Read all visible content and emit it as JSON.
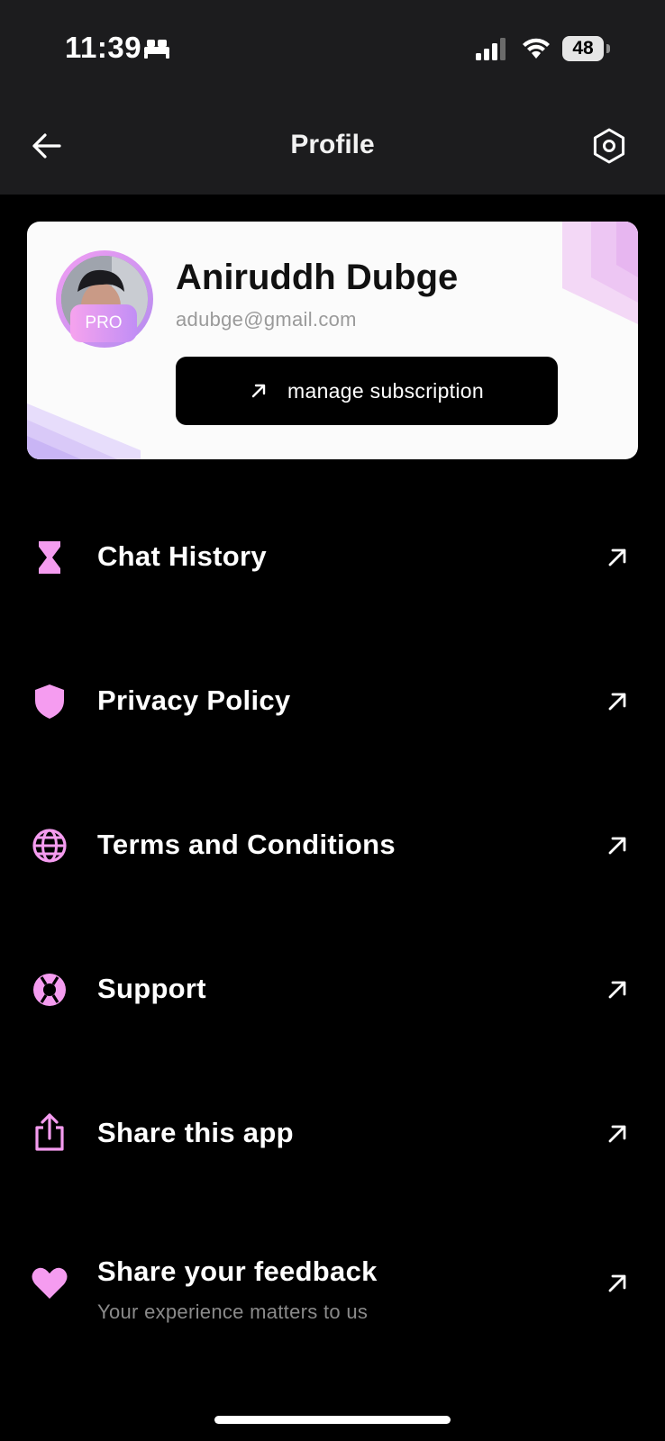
{
  "status_bar": {
    "time": "11:39",
    "battery": "48",
    "icons": [
      "bed-icon",
      "signal-icon",
      "wifi-icon",
      "battery-icon"
    ]
  },
  "header": {
    "title": "Profile",
    "back_icon": "arrow-left-icon",
    "settings_icon": "hexagon-settings-icon"
  },
  "profile": {
    "name": "Aniruddh Dubge",
    "email": "adubge@gmail.com",
    "badge": "PRO",
    "manage_label": "manage subscription"
  },
  "menu": {
    "items": [
      {
        "label": "Chat History",
        "icon": "hourglass-icon"
      },
      {
        "label": "Privacy Policy",
        "icon": "shield-icon"
      },
      {
        "label": "Terms and Conditions",
        "icon": "globe-icon"
      },
      {
        "label": "Support",
        "icon": "lifebuoy-icon"
      },
      {
        "label": "Share this app",
        "icon": "share-icon"
      },
      {
        "label": "Share your feedback",
        "sublabel": "Your experience matters to us",
        "icon": "heart-icon"
      }
    ]
  },
  "colors": {
    "accent": "#f59cf0",
    "header_bg": "#1c1c1e",
    "background": "#000000",
    "card_bg": "#fbfbfb"
  }
}
